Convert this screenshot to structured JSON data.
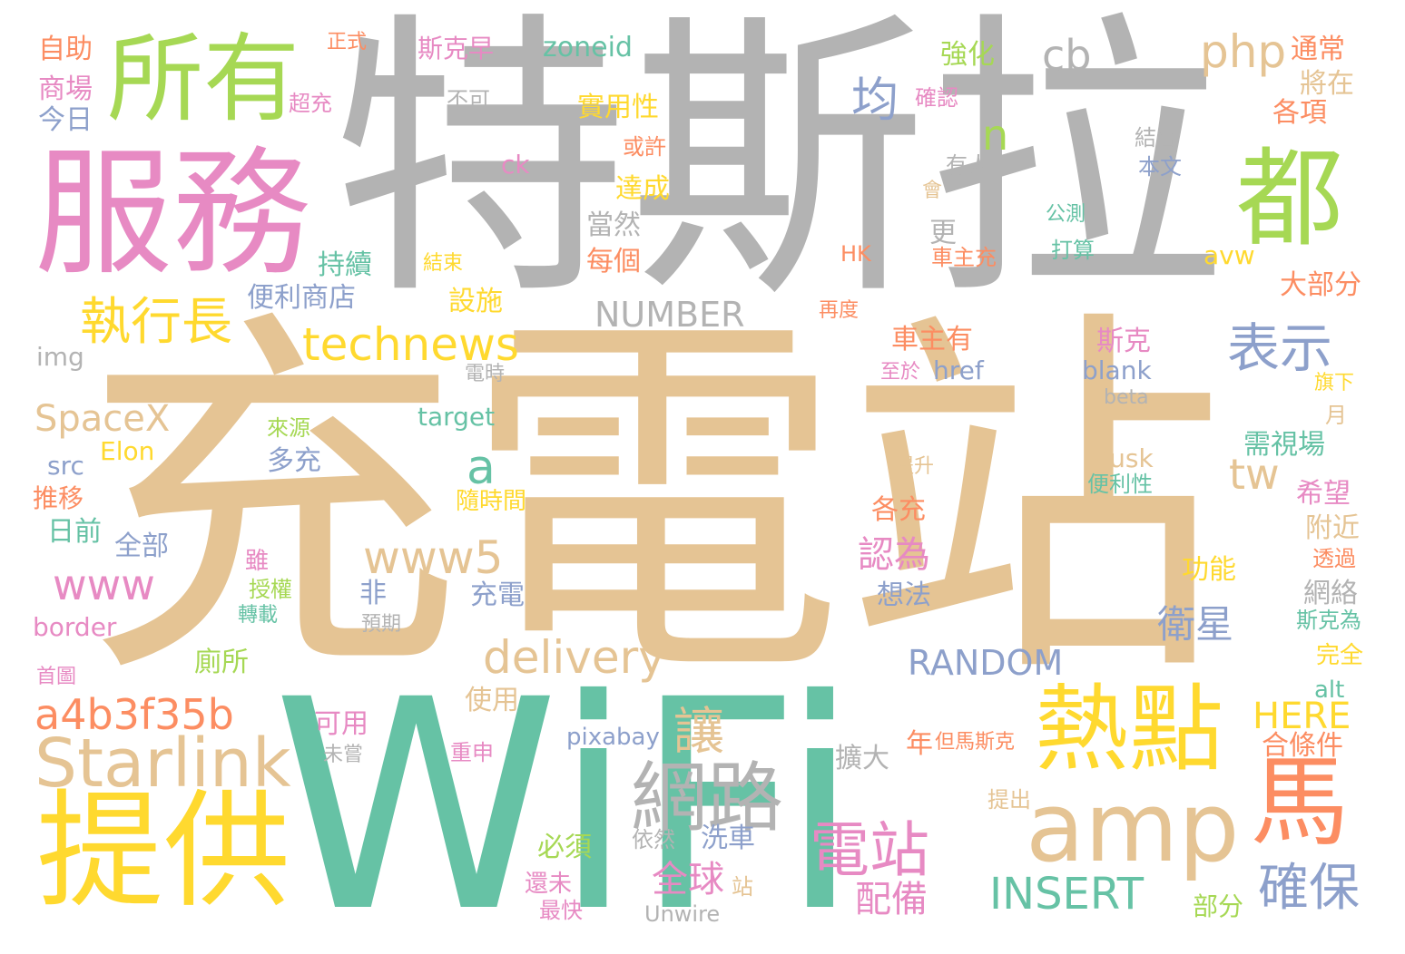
{
  "title": "",
  "colors": {
    "background": "#ffffff",
    "gray": "#b3b3b3",
    "tan": "#e5c494",
    "green": "#66c2a5",
    "pink": "#e78ac3",
    "yellow": "#ffd92f",
    "lime": "#a6d854",
    "blue": "#8da0cb",
    "orange": "#fc8d62"
  },
  "words": [
    {
      "text": "充電站",
      "color": "#e5c494"
    },
    {
      "text": "特斯拉",
      "color": "#b3b3b3"
    },
    {
      "text": "WiFi",
      "color": "#66c2a5"
    },
    {
      "text": "服務",
      "color": "#e78ac3"
    },
    {
      "text": "所有",
      "color": "#a6d854"
    },
    {
      "text": "提供",
      "color": "#ffd92f"
    },
    {
      "text": "都",
      "color": "#a6d854"
    },
    {
      "text": "熱點",
      "color": "#ffd92f"
    },
    {
      "text": "amp",
      "color": "#e5c494"
    },
    {
      "text": "馬",
      "color": "#fc8d62"
    },
    {
      "text": "網路",
      "color": "#b3b3b3"
    },
    {
      "text": "Starlink",
      "color": "#e5c494"
    },
    {
      "text": "電站",
      "color": "#e78ac3"
    },
    {
      "text": "technews",
      "color": "#ffd92f"
    },
    {
      "text": "執行長",
      "color": "#ffd92f"
    },
    {
      "text": "表示",
      "color": "#8da0cb"
    },
    {
      "text": "www5",
      "color": "#e5c494"
    },
    {
      "text": "delivery",
      "color": "#e5c494"
    },
    {
      "text": "a4b3f35b",
      "color": "#fc8d62"
    },
    {
      "text": "php",
      "color": "#e5c494"
    },
    {
      "text": "均",
      "color": "#8da0cb"
    },
    {
      "text": "確保",
      "color": "#8da0cb"
    },
    {
      "text": "INSERT",
      "color": "#66c2a5"
    },
    {
      "text": "www",
      "color": "#e78ac3"
    },
    {
      "text": "讓",
      "color": "#e5c494"
    },
    {
      "text": "RANDOM",
      "color": "#8da0cb"
    },
    {
      "text": "NUMBER",
      "color": "#b3b3b3"
    },
    {
      "text": "全球",
      "color": "#e78ac3"
    },
    {
      "text": "配備",
      "color": "#e78ac3"
    },
    {
      "text": "衛星",
      "color": "#8da0cb"
    },
    {
      "text": "SpaceX",
      "color": "#e5c494"
    },
    {
      "text": "cb",
      "color": "#b3b3b3"
    },
    {
      "text": "n",
      "color": "#a6d854"
    },
    {
      "text": "a",
      "color": "#66c2a5"
    },
    {
      "text": "tw",
      "color": "#e5c494"
    },
    {
      "text": "HERE",
      "color": "#ffd92f"
    },
    {
      "text": "認為",
      "color": "#e78ac3"
    },
    {
      "text": "通常",
      "color": "#fc8d62"
    },
    {
      "text": "將在",
      "color": "#e5c494"
    },
    {
      "text": "各項",
      "color": "#fc8d62"
    },
    {
      "text": "大部分",
      "color": "#fc8d62"
    },
    {
      "text": "avw",
      "color": "#ffd92f"
    },
    {
      "text": "車主有",
      "color": "#fc8d62"
    },
    {
      "text": "斯克",
      "color": "#e78ac3"
    },
    {
      "text": "blank",
      "color": "#8da0cb"
    },
    {
      "text": "href",
      "color": "#8da0cb"
    },
    {
      "text": "至於",
      "color": "#e78ac3"
    },
    {
      "text": "需視場",
      "color": "#66c2a5"
    },
    {
      "text": "希望",
      "color": "#e78ac3"
    },
    {
      "text": "附近",
      "color": "#e5c494"
    },
    {
      "text": "網絡",
      "color": "#b3b3b3"
    },
    {
      "text": "斯克為",
      "color": "#66c2a5"
    },
    {
      "text": "完全",
      "color": "#ffd92f"
    },
    {
      "text": "alt",
      "color": "#66c2a5"
    },
    {
      "text": "合條件",
      "color": "#fc8d62"
    },
    {
      "text": "但馬斯克",
      "color": "#fc8d62"
    },
    {
      "text": "年",
      "color": "#fc8d62"
    },
    {
      "text": "擴大",
      "color": "#b3b3b3"
    },
    {
      "text": "pixabay",
      "color": "#8da0cb"
    },
    {
      "text": "功能",
      "color": "#ffd92f"
    },
    {
      "text": "透過",
      "color": "#fc8d62"
    },
    {
      "text": "Musk",
      "color": "#e5c494"
    },
    {
      "text": "便利性",
      "color": "#66c2a5"
    },
    {
      "text": "提升",
      "color": "#e5c494"
    },
    {
      "text": "beta",
      "color": "#b3b3b3"
    },
    {
      "text": "旗下",
      "color": "#ffd92f"
    },
    {
      "text": "月",
      "color": "#e5c494"
    },
    {
      "text": "電時",
      "color": "#b3b3b3"
    },
    {
      "text": "zoneid",
      "color": "#66c2a5"
    },
    {
      "text": "斯克早",
      "color": "#e78ac3"
    },
    {
      "text": "正式",
      "color": "#fc8d62"
    },
    {
      "text": "強化",
      "color": "#a6d854"
    },
    {
      "text": "確認",
      "color": "#e78ac3"
    },
    {
      "text": "自助",
      "color": "#fc8d62"
    },
    {
      "text": "商場",
      "color": "#e78ac3"
    },
    {
      "text": "今日",
      "color": "#8da0cb"
    },
    {
      "text": "超充",
      "color": "#e78ac3"
    },
    {
      "text": "不可",
      "color": "#b3b3b3"
    },
    {
      "text": "實用性",
      "color": "#ffd92f"
    },
    {
      "text": "或許",
      "color": "#fc8d62"
    },
    {
      "text": "ck",
      "color": "#e78ac3"
    },
    {
      "text": "達成",
      "color": "#ffd92f"
    },
    {
      "text": "當然",
      "color": "#b3b3b3"
    },
    {
      "text": "每個",
      "color": "#fc8d62"
    },
    {
      "text": "結束",
      "color": "#ffd92f"
    },
    {
      "text": "設施",
      "color": "#ffd92f"
    },
    {
      "text": "持續",
      "color": "#66c2a5"
    },
    {
      "text": "便利商店",
      "color": "#8da0cb"
    },
    {
      "text": "結合",
      "color": "#b3b3b3"
    },
    {
      "text": "本文",
      "color": "#8da0cb"
    },
    {
      "text": "有人",
      "color": "#b3b3b3"
    },
    {
      "text": "會",
      "color": "#e5c494"
    },
    {
      "text": "公測",
      "color": "#66c2a5"
    },
    {
      "text": "打算",
      "color": "#66c2a5"
    },
    {
      "text": "車主充",
      "color": "#fc8d62"
    },
    {
      "text": "更",
      "color": "#b3b3b3"
    },
    {
      "text": "HK",
      "color": "#fc8d62"
    },
    {
      "text": "再度",
      "color": "#fc8d62"
    },
    {
      "text": "img",
      "color": "#b3b3b3"
    },
    {
      "text": "來源",
      "color": "#a6d854"
    },
    {
      "text": "target",
      "color": "#66c2a5"
    },
    {
      "text": "Elon",
      "color": "#ffd92f"
    },
    {
      "text": "src",
      "color": "#8da0cb"
    },
    {
      "text": "多充",
      "color": "#8da0cb"
    },
    {
      "text": "推移",
      "color": "#fc8d62"
    },
    {
      "text": "隨時間",
      "color": "#ffd92f"
    },
    {
      "text": "日前",
      "color": "#66c2a5"
    },
    {
      "text": "全部",
      "color": "#8da0cb"
    },
    {
      "text": "各充",
      "color": "#fc8d62"
    },
    {
      "text": "雖",
      "color": "#e78ac3"
    },
    {
      "text": "授權",
      "color": "#a6d854"
    },
    {
      "text": "轉載",
      "color": "#66c2a5"
    },
    {
      "text": "非",
      "color": "#8da0cb"
    },
    {
      "text": "充電",
      "color": "#8da0cb"
    },
    {
      "text": "想法",
      "color": "#8da0cb"
    },
    {
      "text": "border",
      "color": "#e78ac3"
    },
    {
      "text": "預期",
      "color": "#b3b3b3"
    },
    {
      "text": "廁所",
      "color": "#a6d854"
    },
    {
      "text": "首圖",
      "color": "#e78ac3"
    },
    {
      "text": "使用",
      "color": "#e5c494"
    },
    {
      "text": "可用",
      "color": "#e78ac3"
    },
    {
      "text": "未嘗",
      "color": "#b3b3b3"
    },
    {
      "text": "重申",
      "color": "#e78ac3"
    },
    {
      "text": "洗車",
      "color": "#8da0cb"
    },
    {
      "text": "必須",
      "color": "#a6d854"
    },
    {
      "text": "依然",
      "color": "#b3b3b3"
    },
    {
      "text": "還未",
      "color": "#e78ac3"
    },
    {
      "text": "站",
      "color": "#e5c494"
    },
    {
      "text": "最快",
      "color": "#e78ac3"
    },
    {
      "text": "Unwire",
      "color": "#b3b3b3"
    },
    {
      "text": "提出",
      "color": "#e5c494"
    },
    {
      "text": "部分",
      "color": "#a6d854"
    }
  ]
}
